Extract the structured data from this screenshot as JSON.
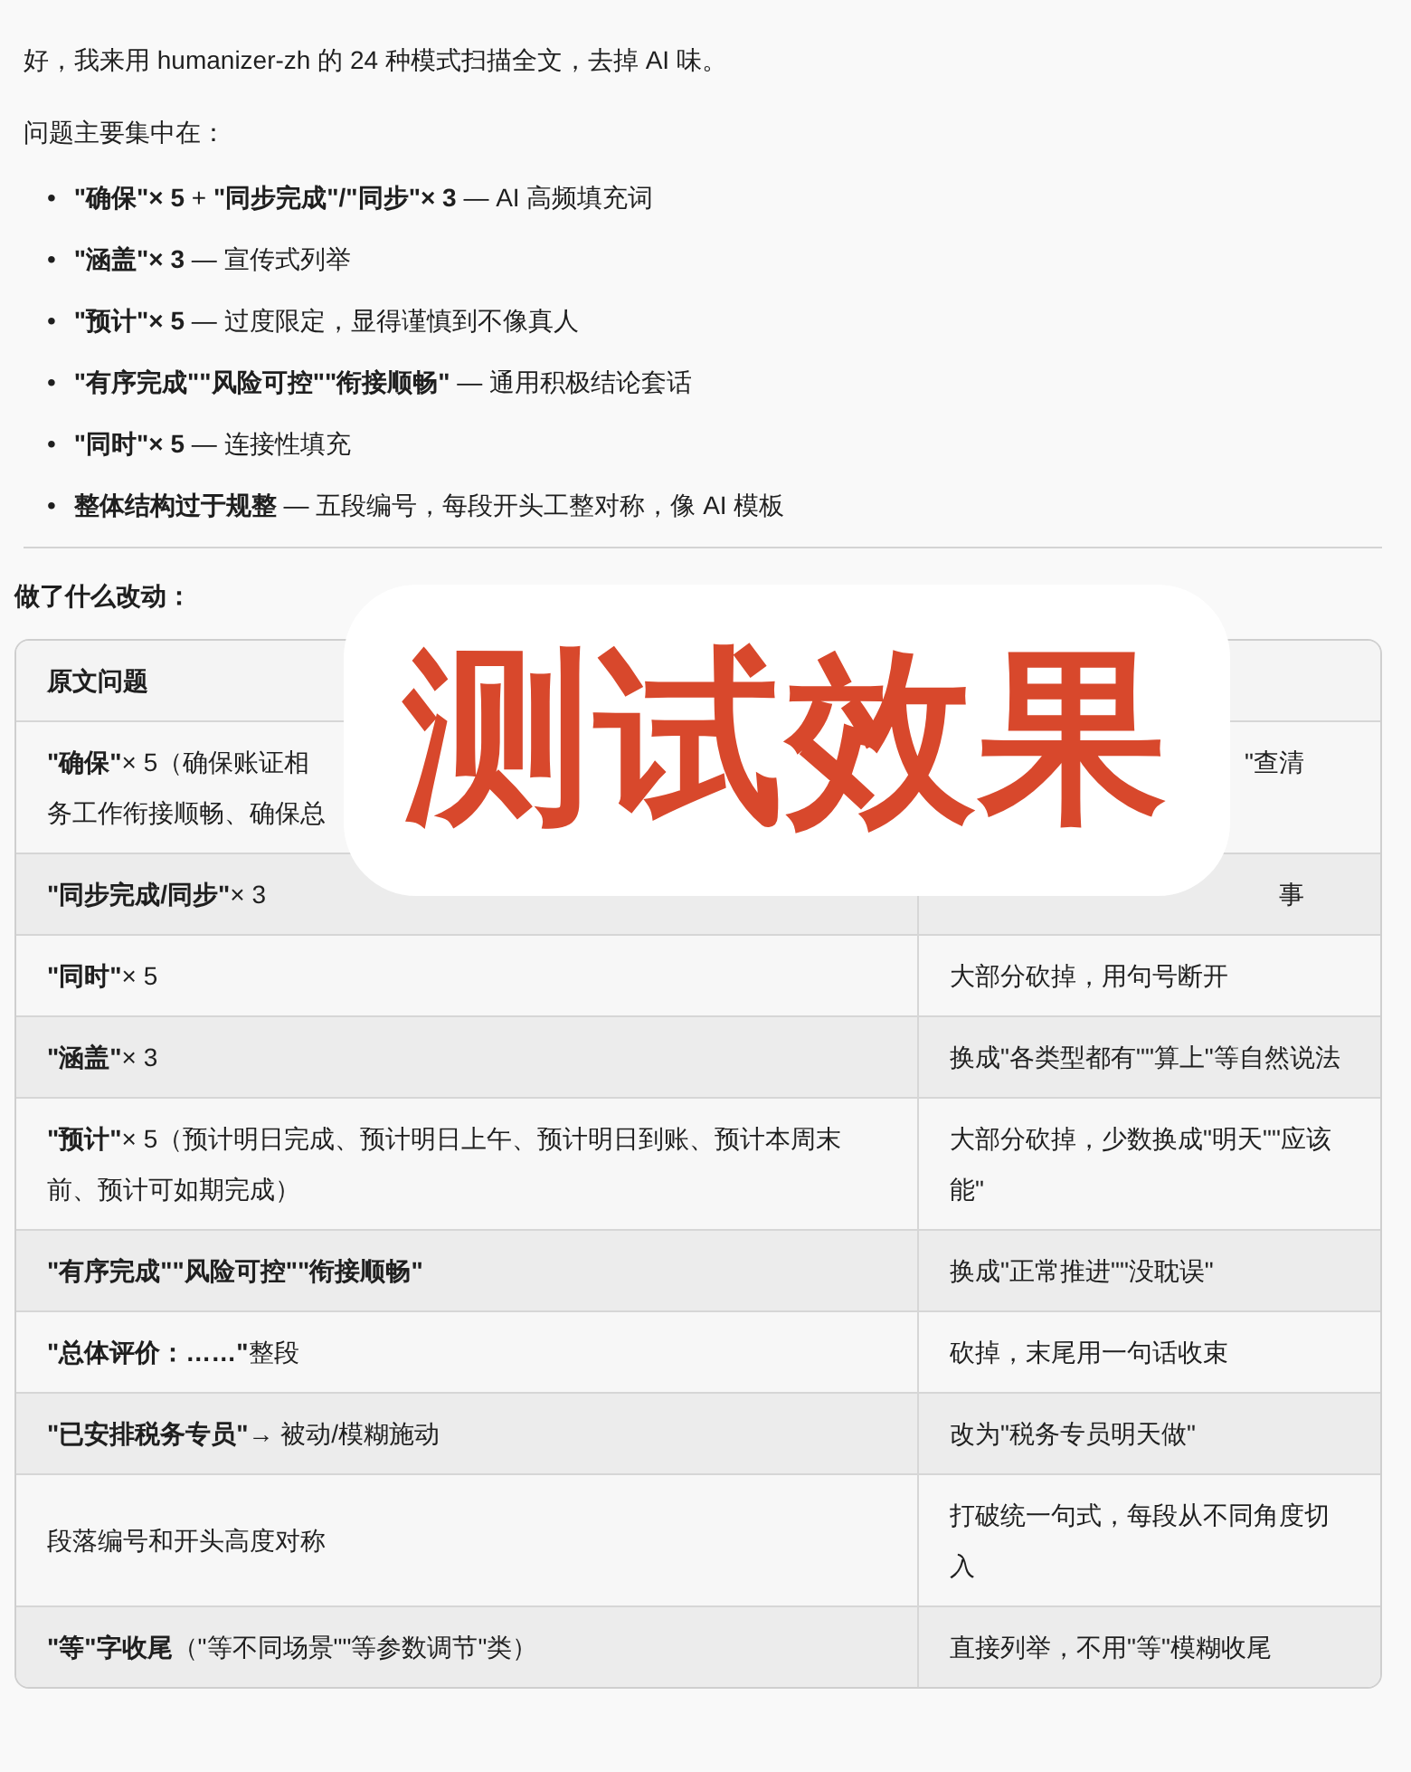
{
  "intro": "好，我来用 humanizer-zh 的 24 种模式扫描全文，去掉 AI 味。",
  "problems_heading": "问题主要集中在：",
  "problems": [
    {
      "bullet": "•",
      "text": "**\"确保\"× 5** + **\"同步完成\"/\"同步\"× 3** — AI 高频填充词"
    },
    {
      "bullet": "•",
      "text": "**\"涵盖\"× 3** — 宣传式列举"
    },
    {
      "bullet": "•",
      "text": "**\"预计\"× 5** — 过度限定，显得谨慎到不像真人"
    },
    {
      "bullet": "•",
      "text": "**\"有序完成\"\"风险可控\"\"衔接顺畅\"** — 通用积极结论套话"
    },
    {
      "bullet": "•",
      "text": "**\"同时\"× 5** — 连接性填充"
    },
    {
      "bullet": "•",
      "text": "**整体结构过于规整** — 五段编号，每段开头工整对称，像 AI 模板"
    }
  ],
  "changes_heading": "做了什么改动：",
  "table": {
    "columns": [
      "原文问题"
    ],
    "rows": [
      {
        "cells": [
          {
            "kind": "partial",
            "lines": [
              "**\"确保\"**× 5（确保账证相",
              "务工作衔接顺畅、确保总"
            ]
          },
          {
            "kind": "partial-end",
            "lines": [
              "\"查清"
            ]
          }
        ]
      },
      {
        "cells": [
          {
            "text": "**\"同步完成/同步\"**× 3"
          },
          {
            "kind": "partial-end",
            "lines": [
              "事"
            ]
          }
        ]
      },
      {
        "cells": [
          {
            "text": "**\"同时\"**× 5"
          },
          {
            "text": "大部分砍掉，用句号断开"
          }
        ]
      },
      {
        "cells": [
          {
            "text": "**\"涵盖\"**× 3"
          },
          {
            "text": "换成\"各类型都有\"\"算上\"等自然说法"
          }
        ]
      },
      {
        "cells": [
          {
            "text": "**\"预计\"**× 5（预计明日完成、预计明日上午、预计明日到账、预计本周末前、预计可如期完成）"
          },
          {
            "text": "大部分砍掉，少数换成\"明天\"\"应该能\""
          }
        ]
      },
      {
        "cells": [
          {
            "text": "**\"有序完成\"\"风险可控\"\"衔接顺畅\"**"
          },
          {
            "text": "换成\"正常推进\"\"没耽误\""
          }
        ]
      },
      {
        "cells": [
          {
            "text": "**\"总体评价：……\"**整段"
          },
          {
            "text": "砍掉，末尾用一句话收束"
          }
        ]
      },
      {
        "cells": [
          {
            "text": "**\"已安排税务专员\"**→ 被动/模糊施动"
          },
          {
            "text": "改为\"税务专员明天做\""
          }
        ]
      },
      {
        "cells": [
          {
            "text": "段落编号和开头高度对称"
          },
          {
            "text": "打破统一句式，每段从不同角度切入"
          }
        ]
      },
      {
        "cells": [
          {
            "text": "**\"等\"字收尾**（\"等不同场景\"\"等参数调节\"类）"
          },
          {
            "text": "直接列举，不用\"等\"模糊收尾"
          }
        ]
      }
    ]
  },
  "overlay": {
    "text": "测试效果"
  }
}
